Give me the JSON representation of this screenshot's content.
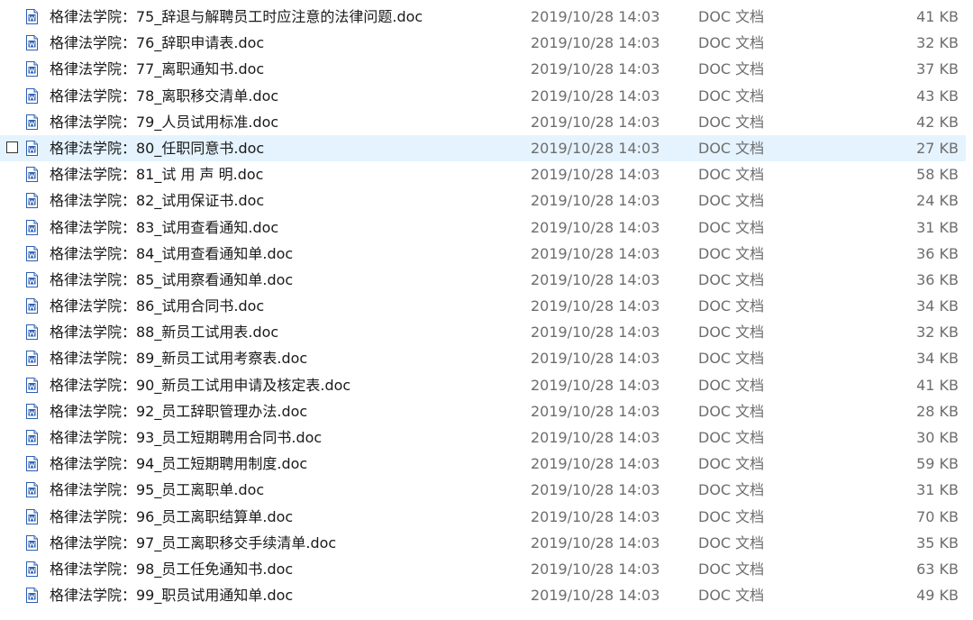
{
  "files": [
    {
      "name": "格律法学院：75_辞退与解聘员工时应注意的法律问题.doc",
      "date": "2019/10/28 14:03",
      "type": "DOC 文档",
      "size": "41 KB",
      "selected": false
    },
    {
      "name": "格律法学院：76_辞职申请表.doc",
      "date": "2019/10/28 14:03",
      "type": "DOC 文档",
      "size": "32 KB",
      "selected": false
    },
    {
      "name": "格律法学院：77_离职通知书.doc",
      "date": "2019/10/28 14:03",
      "type": "DOC 文档",
      "size": "37 KB",
      "selected": false
    },
    {
      "name": "格律法学院：78_离职移交清单.doc",
      "date": "2019/10/28 14:03",
      "type": "DOC 文档",
      "size": "43 KB",
      "selected": false
    },
    {
      "name": "格律法学院：79_人员试用标准.doc",
      "date": "2019/10/28 14:03",
      "type": "DOC 文档",
      "size": "42 KB",
      "selected": false
    },
    {
      "name": "格律法学院：80_任职同意书.doc",
      "date": "2019/10/28 14:03",
      "type": "DOC 文档",
      "size": "27 KB",
      "selected": true
    },
    {
      "name": "格律法学院：81_试 用 声 明.doc",
      "date": "2019/10/28 14:03",
      "type": "DOC 文档",
      "size": "58 KB",
      "selected": false
    },
    {
      "name": "格律法学院：82_试用保证书.doc",
      "date": "2019/10/28 14:03",
      "type": "DOC 文档",
      "size": "24 KB",
      "selected": false
    },
    {
      "name": "格律法学院：83_试用查看通知.doc",
      "date": "2019/10/28 14:03",
      "type": "DOC 文档",
      "size": "31 KB",
      "selected": false
    },
    {
      "name": "格律法学院：84_试用查看通知单.doc",
      "date": "2019/10/28 14:03",
      "type": "DOC 文档",
      "size": "36 KB",
      "selected": false
    },
    {
      "name": "格律法学院：85_试用察看通知单.doc",
      "date": "2019/10/28 14:03",
      "type": "DOC 文档",
      "size": "36 KB",
      "selected": false
    },
    {
      "name": "格律法学院：86_试用合同书.doc",
      "date": "2019/10/28 14:03",
      "type": "DOC 文档",
      "size": "34 KB",
      "selected": false
    },
    {
      "name": "格律法学院：88_新员工试用表.doc",
      "date": "2019/10/28 14:03",
      "type": "DOC 文档",
      "size": "32 KB",
      "selected": false
    },
    {
      "name": "格律法学院：89_新员工试用考察表.doc",
      "date": "2019/10/28 14:03",
      "type": "DOC 文档",
      "size": "34 KB",
      "selected": false
    },
    {
      "name": "格律法学院：90_新员工试用申请及核定表.doc",
      "date": "2019/10/28 14:03",
      "type": "DOC 文档",
      "size": "41 KB",
      "selected": false
    },
    {
      "name": "格律法学院：92_员工辞职管理办法.doc",
      "date": "2019/10/28 14:03",
      "type": "DOC 文档",
      "size": "28 KB",
      "selected": false
    },
    {
      "name": "格律法学院：93_员工短期聘用合同书.doc",
      "date": "2019/10/28 14:03",
      "type": "DOC 文档",
      "size": "30 KB",
      "selected": false
    },
    {
      "name": "格律法学院：94_员工短期聘用制度.doc",
      "date": "2019/10/28 14:03",
      "type": "DOC 文档",
      "size": "59 KB",
      "selected": false
    },
    {
      "name": "格律法学院：95_员工离职单.doc",
      "date": "2019/10/28 14:03",
      "type": "DOC 文档",
      "size": "31 KB",
      "selected": false
    },
    {
      "name": "格律法学院：96_员工离职结算单.doc",
      "date": "2019/10/28 14:03",
      "type": "DOC 文档",
      "size": "70 KB",
      "selected": false
    },
    {
      "name": "格律法学院：97_员工离职移交手续清单.doc",
      "date": "2019/10/28 14:03",
      "type": "DOC 文档",
      "size": "35 KB",
      "selected": false
    },
    {
      "name": "格律法学院：98_员工任免通知书.doc",
      "date": "2019/10/28 14:03",
      "type": "DOC 文档",
      "size": "63 KB",
      "selected": false
    },
    {
      "name": "格律法学院：99_职员试用通知单.doc",
      "date": "2019/10/28 14:03",
      "type": "DOC 文档",
      "size": "49 KB",
      "selected": false
    }
  ],
  "icon": "word-doc-icon",
  "colors": {
    "selected_row": "#e5f3ff",
    "icon_blue": "#2b5fb3"
  }
}
